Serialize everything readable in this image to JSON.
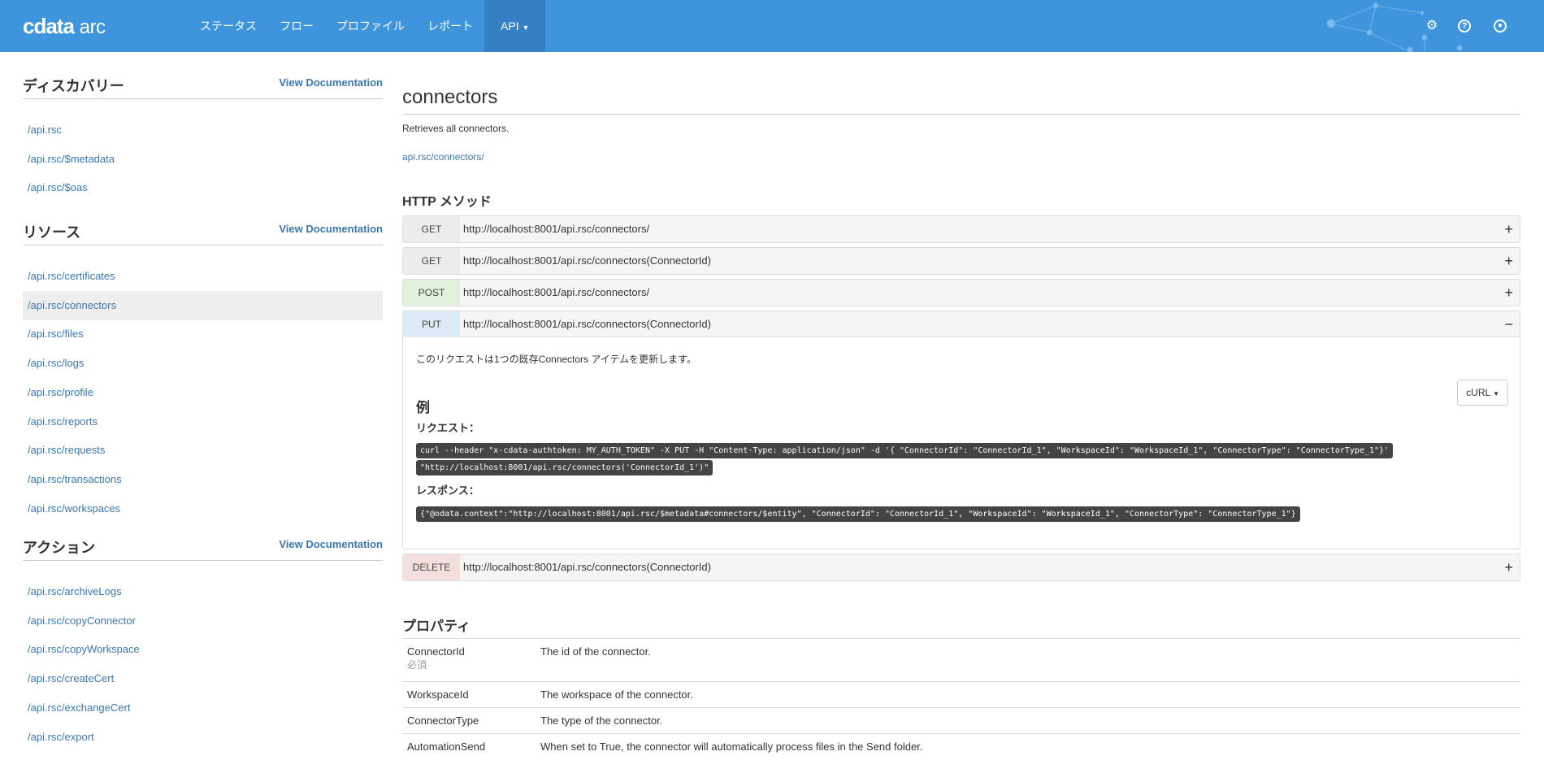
{
  "header": {
    "logo": "cdata arc",
    "nav": [
      "ステータス",
      "フロー",
      "プロファイル",
      "レポート",
      "API"
    ],
    "icons": [
      "gear-icon",
      "help-icon",
      "user-icon"
    ]
  },
  "sidebar": {
    "view_doc": "View Documentation",
    "sections": [
      {
        "title": "ディスカバリー",
        "items": [
          "/api.rsc",
          "/api.rsc/$metadata",
          "/api.rsc/$oas"
        ]
      },
      {
        "title": "リソース",
        "items": [
          "/api.rsc/certificates",
          "/api.rsc/connectors",
          "/api.rsc/files",
          "/api.rsc/logs",
          "/api.rsc/profile",
          "/api.rsc/reports",
          "/api.rsc/requests",
          "/api.rsc/transactions",
          "/api.rsc/workspaces"
        ]
      },
      {
        "title": "アクション",
        "items": [
          "/api.rsc/archiveLogs",
          "/api.rsc/copyConnector",
          "/api.rsc/copyWorkspace",
          "/api.rsc/createCert",
          "/api.rsc/exchangeCert",
          "/api.rsc/export"
        ]
      }
    ]
  },
  "main": {
    "title": "connectors",
    "description": "Retrieves all connectors.",
    "link": "api.rsc/connectors/",
    "methods_heading": "HTTP メソッド",
    "methods": [
      {
        "method": "GET",
        "url": "http://localhost:8001/api.rsc/connectors/",
        "toggle": "+"
      },
      {
        "method": "GET",
        "url": "http://localhost:8001/api.rsc/connectors(ConnectorId)",
        "toggle": "+"
      },
      {
        "method": "POST",
        "url": "http://localhost:8001/api.rsc/connectors/",
        "toggle": "+"
      },
      {
        "method": "PUT",
        "url": "http://localhost:8001/api.rsc/connectors(ConnectorId)",
        "toggle": "−"
      },
      {
        "method": "DELETE",
        "url": "http://localhost:8001/api.rsc/connectors(ConnectorId)",
        "toggle": "+"
      }
    ],
    "put_detail": {
      "description": "このリクエストは1つの既存Connectors アイテムを更新します。",
      "example_heading": "例",
      "lang_button": "cURL",
      "request_label": "リクエスト：",
      "request_line1": "curl --header \"x-cdata-authtoken: MY_AUTH_TOKEN\" -X PUT -H \"Content-Type: application/json\" -d '{ \"ConnectorId\": \"ConnectorId_1\", \"WorkspaceId\": \"WorkspaceId_1\", \"ConnectorType\": \"ConnectorType_1\"}'",
      "request_line2": "\"http://localhost:8001/api.rsc/connectors('ConnectorId_1')\"",
      "response_label": "レスポンス：",
      "response": "{\"@odata.context\":\"http://localhost:8001/api.rsc/$metadata#connectors/$entity\", \"ConnectorId\": \"ConnectorId_1\", \"WorkspaceId\": \"WorkspaceId_1\", \"ConnectorType\": \"ConnectorType_1\"}"
    },
    "properties_heading": "プロパティ",
    "properties": [
      {
        "name": "ConnectorId",
        "note": "必須",
        "desc": "The id of the connector."
      },
      {
        "name": "WorkspaceId",
        "desc": "The workspace of the connector."
      },
      {
        "name": "ConnectorType",
        "desc": "The type of the connector."
      },
      {
        "name": "AutomationSend",
        "desc": "When set to True, the connector will automatically process files in the Send folder."
      }
    ]
  }
}
